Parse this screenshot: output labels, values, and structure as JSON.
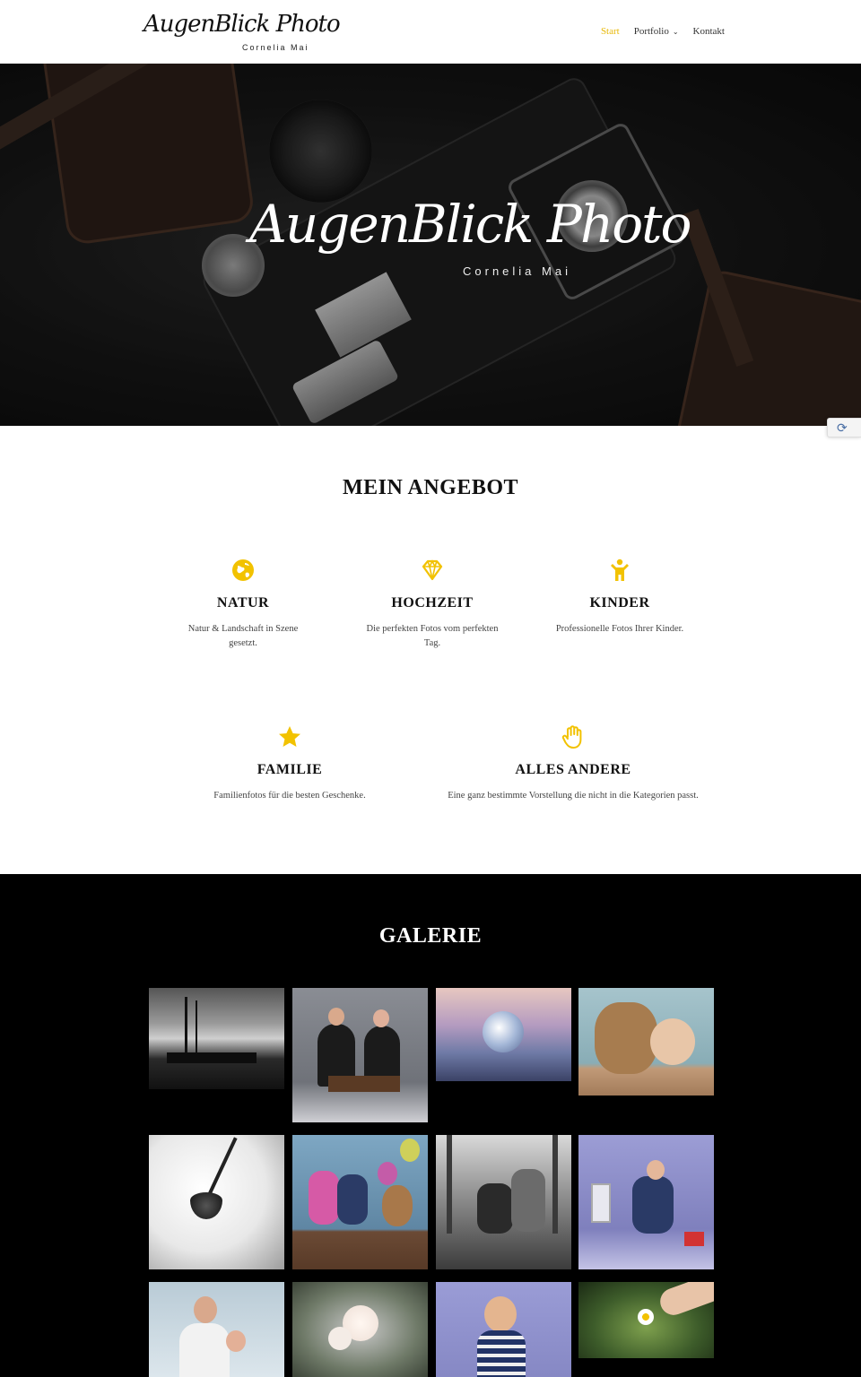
{
  "header": {
    "logo_script": "AugenBlick Photo",
    "logo_sub": "Cornelia Mai",
    "nav": [
      {
        "label": "Start",
        "active": true
      },
      {
        "label": "Portfolio",
        "dropdown": true
      },
      {
        "label": "Kontakt"
      }
    ]
  },
  "hero": {
    "title": "AugenBlick Photo",
    "subtitle": "Cornelia Mai"
  },
  "offers": {
    "title": "MEIN ANGEBOT",
    "accent_color": "#f2c200",
    "items": [
      {
        "icon": "globe-icon",
        "title": "NATUR",
        "text": "Natur & Landschaft in Szene gesetzt."
      },
      {
        "icon": "diamond-icon",
        "title": "HOCHZEIT",
        "text": "Die perfekten Fotos vom perfekten Tag."
      },
      {
        "icon": "child-icon",
        "title": "KINDER",
        "text": "Professionelle Fotos Ihrer Kinder."
      },
      {
        "icon": "star-icon",
        "title": "FAMILIE",
        "text": "Familienfotos für die besten Geschenke."
      },
      {
        "icon": "hand-icon",
        "title": "ALLES ANDERE",
        "text": "Eine ganz bestimmte Vorstellung die nicht in die Kategorien passt."
      }
    ]
  },
  "gallery": {
    "title": "GALERIE",
    "images": [
      "harbor-sunset-photo",
      "family-portrait-photo",
      "glass-ball-beach-photo",
      "baby-teddy-photo",
      "water-drop-photo",
      "kids-balloons-photo",
      "couple-forest-bw-photo",
      "family-lantern-photo",
      "couple-baby-photo",
      "cherry-blossom-photo",
      "toddler-portrait-photo",
      "flower-hand-photo"
    ]
  }
}
